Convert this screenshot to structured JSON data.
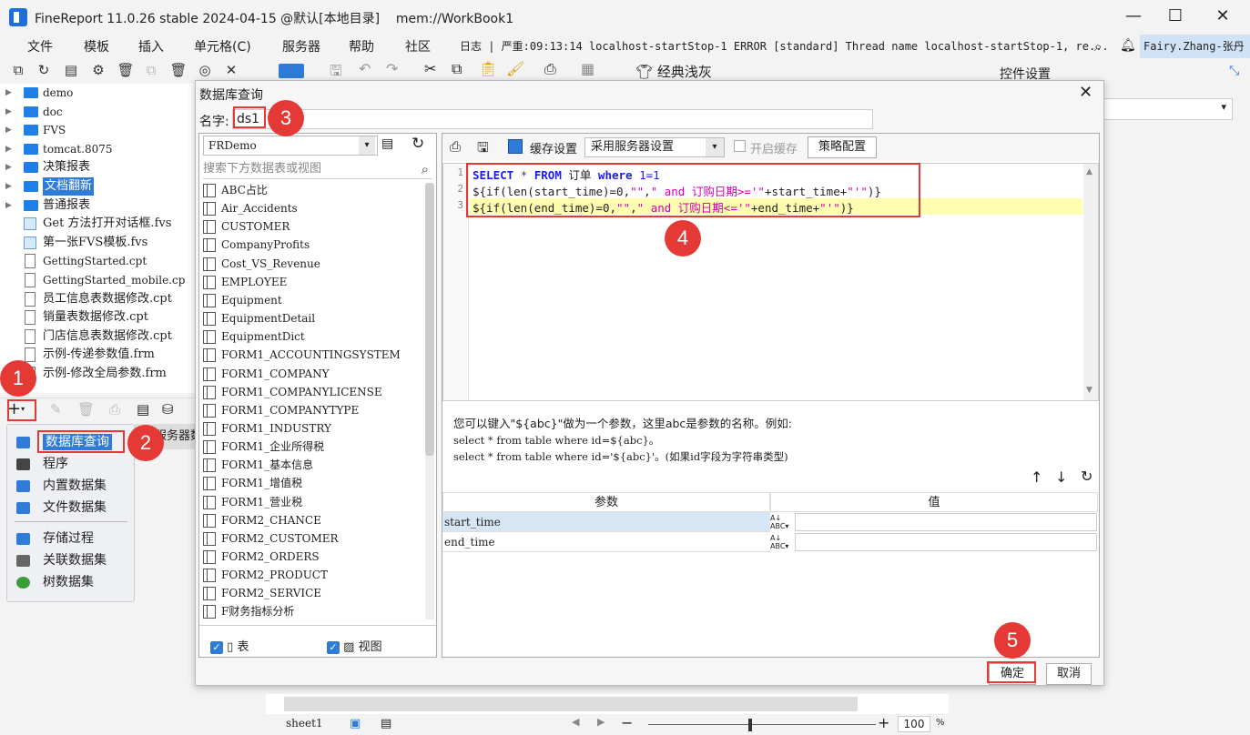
{
  "window": {
    "title": "FineReport 11.0.26 stable 2024-04-15 @默认[本地目录]    mem://WorkBook1",
    "minimize": "—",
    "maximize": "☐",
    "close": "✕"
  },
  "menubar": {
    "items": [
      "文件",
      "模板",
      "插入",
      "单元格(C)",
      "服务器",
      "帮助",
      "社区"
    ],
    "log": "日志 | 严重:09:13:14 localhost-startStop-1 ERROR [standard] Thread name localhost-startStop-1, re...",
    "user": "Fairy.Zhang-张丹"
  },
  "toolbar": {
    "theme_label": "经典浅灰"
  },
  "tree": {
    "items": [
      {
        "type": "folder",
        "label": "demo"
      },
      {
        "type": "folder",
        "label": "doc"
      },
      {
        "type": "folder",
        "label": "FVS"
      },
      {
        "type": "folder",
        "label": "tomcat.8075"
      },
      {
        "type": "folder",
        "label": "决策报表"
      },
      {
        "type": "folder",
        "label": "文档翻新"
      },
      {
        "type": "folder",
        "label": "普通报表"
      },
      {
        "type": "fvs",
        "label": "Get 方法打开对话框.fvs"
      },
      {
        "type": "fvs",
        "label": "第一张FVS模板.fvs"
      },
      {
        "type": "file",
        "label": "GettingStarted.cpt"
      },
      {
        "type": "file",
        "label": "GettingStarted_mobile.cp"
      },
      {
        "type": "file",
        "label": "员工信息表数据修改.cpt"
      },
      {
        "type": "file",
        "label": "销量表数据修改.cpt"
      },
      {
        "type": "file",
        "label": "门店信息表数据修改.cpt"
      },
      {
        "type": "file",
        "label": "示例-传递参数值.frm"
      },
      {
        "type": "file",
        "label": "示例-修改全局参数.frm"
      }
    ]
  },
  "ds_menu": {
    "add_label": "+",
    "items": [
      "数据库查询",
      "程序",
      "内置数据集",
      "文件数据集",
      "存储过程",
      "关联数据集",
      "树数据集"
    ],
    "partial_tab": "服务器数"
  },
  "right_panel": {
    "title": "控件设置"
  },
  "dialog": {
    "title": "数据库查询",
    "close": "✕",
    "name_label": "名字:",
    "name_value": "ds1",
    "connection": "FRDemo",
    "search_placeholder": "搜索下方数据表或视图",
    "tables": [
      "ABC占比",
      "Air_Accidents",
      "CUSTOMER",
      "CompanyProfits",
      "Cost_VS_Revenue",
      "EMPLOYEE",
      "Equipment",
      "EquipmentDetail",
      "EquipmentDict",
      "FORM1_ACCOUNTINGSYSTEM",
      "FORM1_COMPANY",
      "FORM1_COMPANYLICENSE",
      "FORM1_COMPANYTYPE",
      "FORM1_INDUSTRY",
      "FORM1_企业所得税",
      "FORM1_基本信息",
      "FORM1_增值税",
      "FORM1_营业税",
      "FORM2_CHANCE",
      "FORM2_CUSTOMER",
      "FORM2_ORDERS",
      "FORM2_PRODUCT",
      "FORM2_SERVICE",
      "F财务指标分析"
    ],
    "show_tables_label": "表",
    "show_views_label": "视图",
    "cache_label": "缓存设置",
    "cache_value": "采用服务器设置",
    "enable_cache_label": "开启缓存",
    "strategy_button": "策略配置",
    "sql_lines": [
      "SELECT * FROM 订单 where 1=1",
      "${if(len(start_time)=0,\"\",\" and 订购日期>='\"+start_time+\"'\")}",
      "${if(len(end_time)=0,\"\",\" and 订购日期<='\"+end_time+\"'\")}"
    ],
    "hint_line1": "您可以键入\"${abc}\"做为一个参数，这里abc是参数的名称。例如:",
    "hint_line2": "select * from table where id=${abc}。",
    "hint_line3": "select * from table where id='${abc}'。(如果id字段为字符串类型)",
    "param_header": "参数",
    "value_header": "值",
    "params": [
      {
        "name": "start_time",
        "value": ""
      },
      {
        "name": "end_time",
        "value": ""
      }
    ],
    "ok_button": "确定",
    "cancel_button": "取消"
  },
  "sheetbar": {
    "sheet_name": "sheet1",
    "zoom": "100",
    "zoom_unit": "%"
  },
  "annotations": [
    "1",
    "2",
    "3",
    "4",
    "5"
  ]
}
